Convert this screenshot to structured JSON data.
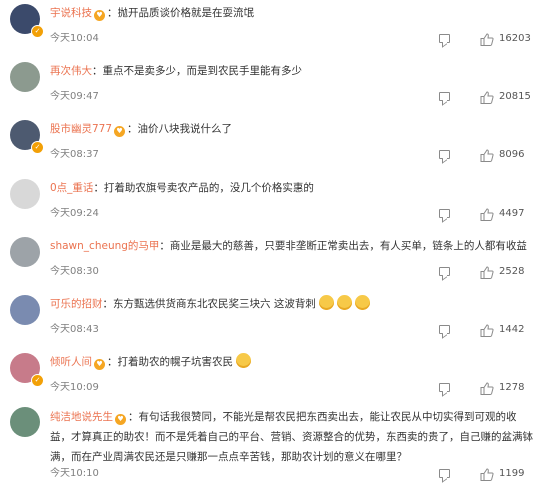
{
  "comments": [
    {
      "username": "宇说科技",
      "text": "：抛开品质谈价格就是在耍流氓",
      "time": "今天10:04",
      "likes": "16203",
      "verified": true,
      "vip": true,
      "avatar_color": "#3b4a6b"
    },
    {
      "username": "再次伟大",
      "text": "：重点不是卖多少，而是到农民手里能有多少",
      "time": "今天09:47",
      "likes": "20815",
      "verified": false,
      "vip": false,
      "avatar_color": "#8c9a8f"
    },
    {
      "username": "股市幽灵777",
      "text": "：油价八块我说什么了",
      "time": "今天08:37",
      "likes": "8096",
      "verified": true,
      "vip": true,
      "avatar_color": "#4d5a70"
    },
    {
      "username": "0点_重话",
      "text": "：打着助农旗号卖农产品的，没几个价格实惠的",
      "time": "今天09:24",
      "likes": "4497",
      "verified": false,
      "vip": false,
      "avatar_color": "#d8d8d8"
    },
    {
      "username": "shawn_cheung的马甲",
      "text": "：商业是最大的慈善，只要非垄断正常卖出去，有人买单，链条上的人都有收益",
      "time": "今天08:30",
      "likes": "2528",
      "verified": false,
      "vip": false,
      "avatar_color": "#9da3a8"
    },
    {
      "username": "可乐的招财",
      "text": "：东方甄选供货商东北农民奖三块六 这波背刺",
      "time": "今天08:43",
      "likes": "1442",
      "verified": false,
      "vip": false,
      "avatar_color": "#7a8bb0",
      "emojis": 3
    },
    {
      "username": "倾听人间",
      "text": "：打着助农的幌子坑害农民",
      "time": "今天10:09",
      "likes": "1278",
      "verified": true,
      "vip": true,
      "avatar_color": "#c77b8a",
      "emojis": 1
    },
    {
      "username": "纯洁地说先生",
      "text": "：有句话我很赞同，不能光是帮农民把东西卖出去，能让农民从中切实得到可观的收益，才算真正的助农！而不是凭着自己的平台、营销、资源整合的优势，东西卖的贵了，自己赚的盆满钵满，而在产业周满农民还是只赚那一点点辛苦钱，那助农计划的意义在哪里？",
      "time": "今天10:10",
      "likes": "1199",
      "verified": false,
      "vip": true,
      "avatar_color": "#6b8f7a"
    }
  ]
}
